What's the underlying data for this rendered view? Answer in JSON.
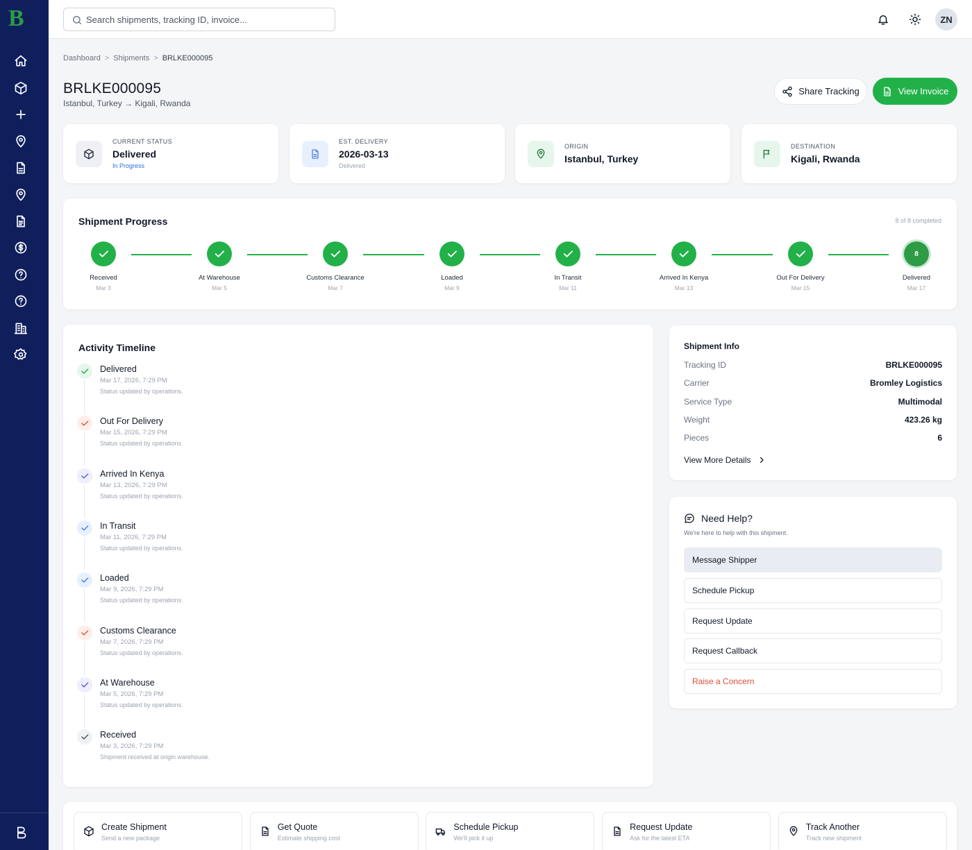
{
  "brand": {
    "logo_letter": "B",
    "accent": "#22b148",
    "sidebar_bg": "#0f1f5c"
  },
  "sidebar": {
    "items": [
      {
        "icon": "home-icon"
      },
      {
        "icon": "package-icon"
      },
      {
        "icon": "plus-icon"
      },
      {
        "icon": "map-pin-icon"
      },
      {
        "icon": "document-icon"
      },
      {
        "icon": "location-icon"
      },
      {
        "icon": "file-text-icon"
      },
      {
        "icon": "dollar-circle-icon"
      },
      {
        "icon": "help-circle-icon"
      },
      {
        "icon": "question-circle-icon"
      },
      {
        "icon": "building-icon"
      },
      {
        "icon": "settings-icon"
      }
    ],
    "bottom_icon": "logout-icon"
  },
  "topbar": {
    "search_placeholder": "Search shipments, tracking ID, invoice...",
    "avatar_initials": "ZN"
  },
  "breadcrumb": {
    "items": [
      "Dashboard",
      "Shipments"
    ],
    "current": "BRLKE000095",
    "separator": ">"
  },
  "header": {
    "title": "BRLKE000095",
    "route": "Istanbul, Turkey → Kigali, Rwanda",
    "share_label": "Share Tracking",
    "invoice_label": "View Invoice"
  },
  "stats": [
    {
      "label": "CURRENT STATUS",
      "value": "Delivered",
      "sub": "In Progress",
      "sub_color": "#2f6fd6",
      "icon": "package-icon",
      "icon_bg": "#eef0f4",
      "icon_color": "#1f2937"
    },
    {
      "label": "EST. DELIVERY",
      "value": "2026-03-13",
      "sub": "Delivered",
      "sub_color": "#9ca3af",
      "icon": "document-icon",
      "icon_bg": "#e8f0fd",
      "icon_color": "#4f86e8"
    },
    {
      "label": "ORIGIN",
      "value": "Istanbul, Turkey",
      "icon": "map-pin-icon",
      "icon_bg": "#e7f6ec",
      "icon_color": "#1f7a3a"
    },
    {
      "label": "DESTINATION",
      "value": "Kigali, Rwanda",
      "icon": "flag-icon",
      "icon_bg": "#e7f6ec",
      "icon_color": "#1f7a3a"
    }
  ],
  "progress": {
    "title": "Shipment Progress",
    "count": "8 of 8 completed",
    "final_number": "8",
    "steps": [
      {
        "label": "Received",
        "date": "Mar 3"
      },
      {
        "label": "At Warehouse",
        "date": "Mar 5"
      },
      {
        "label": "Customs Clearance",
        "date": "Mar 7"
      },
      {
        "label": "Loaded",
        "date": "Mar 9"
      },
      {
        "label": "In Transit",
        "date": "Mar 11"
      },
      {
        "label": "Arrived In Kenya",
        "date": "Mar 13"
      },
      {
        "label": "Out For Delivery",
        "date": "Mar 15"
      },
      {
        "label": "Delivered",
        "date": "Mar 17"
      }
    ]
  },
  "timeline": {
    "title": "Activity Timeline",
    "items": [
      {
        "title": "Delivered",
        "time": "Mar 17, 2026, 7:29 PM",
        "note": "Status updated by operations.",
        "color": "#22b148",
        "bg": "#e7f6ec"
      },
      {
        "title": "Out For Delivery",
        "time": "Mar 15, 2026, 7:29 PM",
        "note": "Status updated by operations.",
        "color": "#e8553a",
        "bg": "#fdeee9"
      },
      {
        "title": "Arrived In Kenya",
        "time": "Mar 13, 2026, 7:29 PM",
        "note": "Status updated by operations.",
        "color": "#5b5ee0",
        "bg": "#eeeefc"
      },
      {
        "title": "In Transit",
        "time": "Mar 11, 2026, 7:29 PM",
        "note": "Status updated by operations.",
        "color": "#3b82f6",
        "bg": "#e8f0fd"
      },
      {
        "title": "Loaded",
        "time": "Mar 9, 2026, 7:29 PM",
        "note": "Status updated by operations.",
        "color": "#3b82f6",
        "bg": "#e8f0fd"
      },
      {
        "title": "Customs Clearance",
        "time": "Mar 7, 2026, 7:29 PM",
        "note": "Status updated by operations.",
        "color": "#e8553a",
        "bg": "#fdeee9"
      },
      {
        "title": "At Warehouse",
        "time": "Mar 5, 2026, 7:29 PM",
        "note": "Status updated by operations.",
        "color": "#5b5ee0",
        "bg": "#eeeefc"
      },
      {
        "title": "Received",
        "time": "Mar 3, 2026, 7:29 PM",
        "note": "Shipment received at origin warehouse.",
        "color": "#4b5563",
        "bg": "#f0f1f3"
      }
    ]
  },
  "shipment_info": {
    "title": "Shipment Info",
    "rows": [
      {
        "key": "Tracking ID",
        "value": "BRLKE000095"
      },
      {
        "key": "Carrier",
        "value": "Bromley Logistics"
      },
      {
        "key": "Service Type",
        "value": "Multimodal"
      },
      {
        "key": "Weight",
        "value": "423.26 kg"
      },
      {
        "key": "Pieces",
        "value": "6"
      }
    ],
    "link": "View More Details"
  },
  "help": {
    "title": "Need Help?",
    "subtitle": "We're here to help with this shipment.",
    "buttons": [
      {
        "label": "Message Shipper",
        "style": "primary"
      },
      {
        "label": "Schedule Pickup",
        "style": "default"
      },
      {
        "label": "Request Update",
        "style": "default"
      },
      {
        "label": "Request Callback",
        "style": "default"
      },
      {
        "label": "Raise a Concern",
        "style": "danger"
      }
    ]
  },
  "quick_actions": [
    {
      "title": "Create Shipment",
      "sub": "Send a new package",
      "icon": "package-icon"
    },
    {
      "title": "Get Quote",
      "sub": "Estimate shipping cost",
      "icon": "document-icon"
    },
    {
      "title": "Schedule Pickup",
      "sub": "We'll pick it up",
      "icon": "truck-icon"
    },
    {
      "title": "Request Update",
      "sub": "Ask for the latest ETA",
      "icon": "document-icon"
    },
    {
      "title": "Track Another",
      "sub": "Track new shipment",
      "icon": "map-pin-icon"
    }
  ]
}
